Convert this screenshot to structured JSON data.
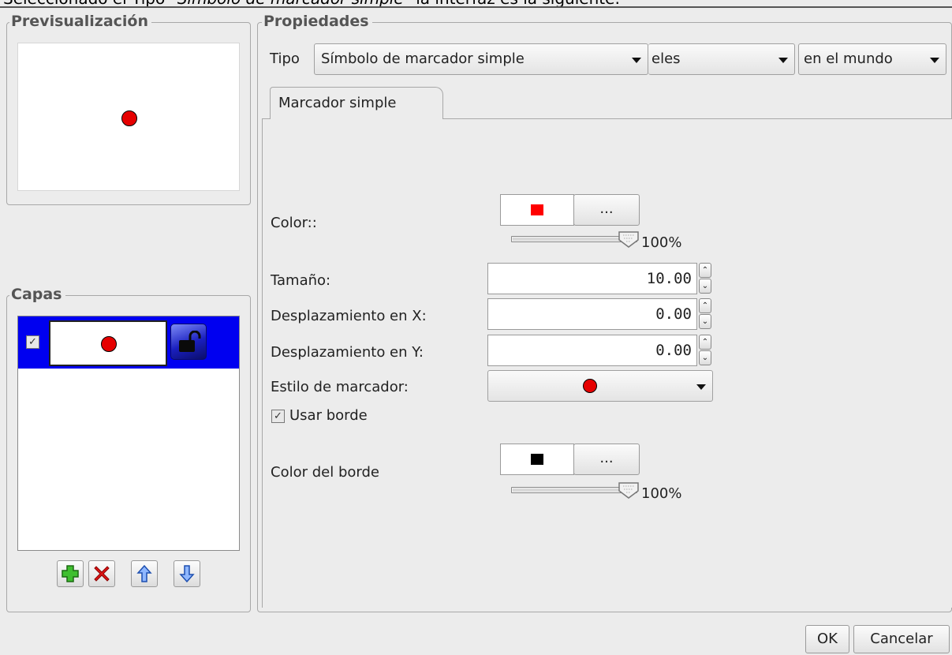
{
  "caption": {
    "prefix": "Seleccionado el Tipo \"",
    "italic": "Símbolo de marcador simple",
    "suffix": "\" la interfaz es la siguiente:"
  },
  "preview": {
    "legend": "Previsualización"
  },
  "layers": {
    "legend": "Capas",
    "items": [
      {
        "checked": true,
        "selected": true
      }
    ],
    "toolbar": [
      "add-icon",
      "delete-icon",
      "up-arrow-icon",
      "down-arrow-icon"
    ]
  },
  "properties": {
    "legend": "Propiedades",
    "type_label": "Tipo",
    "type_value": "Símbolo de marcador simple",
    "units_value": "eles",
    "space_value": "en el mundo",
    "tab_label": "Marcador simple",
    "color_label": "Color::",
    "color_hex": "#ff0000",
    "color_btn": "...",
    "color_alpha": "100%",
    "size_label": "Tamaño:",
    "size_value": "10.00",
    "offset_x_label": "Desplazamiento en X:",
    "offset_x_value": "0.00",
    "offset_y_label": "Desplazamiento en Y:",
    "offset_y_value": "0.00",
    "marker_style_label": "Estilo de marcador:",
    "use_border_label": "Usar borde",
    "use_border_checked": true,
    "border_color_label": "Color del borde",
    "border_color_hex": "#000000",
    "border_btn": "...",
    "border_alpha": "100%"
  },
  "buttons": {
    "ok": "OK",
    "cancel": "Cancelar"
  }
}
